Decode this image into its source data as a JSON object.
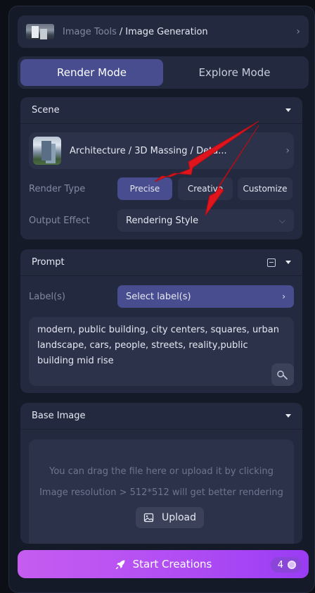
{
  "breadcrumb": {
    "parent": "Image Tools",
    "separator": "/",
    "current": "Image Generation"
  },
  "modes": [
    {
      "label": "Render Mode",
      "active": true
    },
    {
      "label": "Explore Mode",
      "active": false
    }
  ],
  "scene": {
    "title": "Scene",
    "selected": "Architecture / 3D Massing / Deta...",
    "render_type_label": "Render Type",
    "render_types": [
      {
        "label": "Precise",
        "active": true
      },
      {
        "label": "Creative",
        "active": false
      },
      {
        "label": "Customize",
        "active": false
      }
    ],
    "output_effect_label": "Output Effect",
    "output_effect_value": "Rendering Style"
  },
  "prompt": {
    "title": "Prompt",
    "labels_label": "Label(s)",
    "labels_select": "Select label(s)",
    "text": "modern, public building, city centers, squares, urban landscape, cars, people, streets, reality,public building mid rise"
  },
  "base_image": {
    "title": "Base Image",
    "hint_1": "You can drag the file here or upload it by clicking",
    "hint_2": "Image resolution > 512*512 will get better rendering",
    "upload_label": "Upload"
  },
  "start": {
    "label": "Start Creations",
    "credits": "4"
  },
  "colors": {
    "accent": "#474d8e",
    "start_gradient_from": "#c65cf0",
    "start_gradient_to": "#9a3cf4",
    "annotation_arrow": "#e0141c"
  }
}
